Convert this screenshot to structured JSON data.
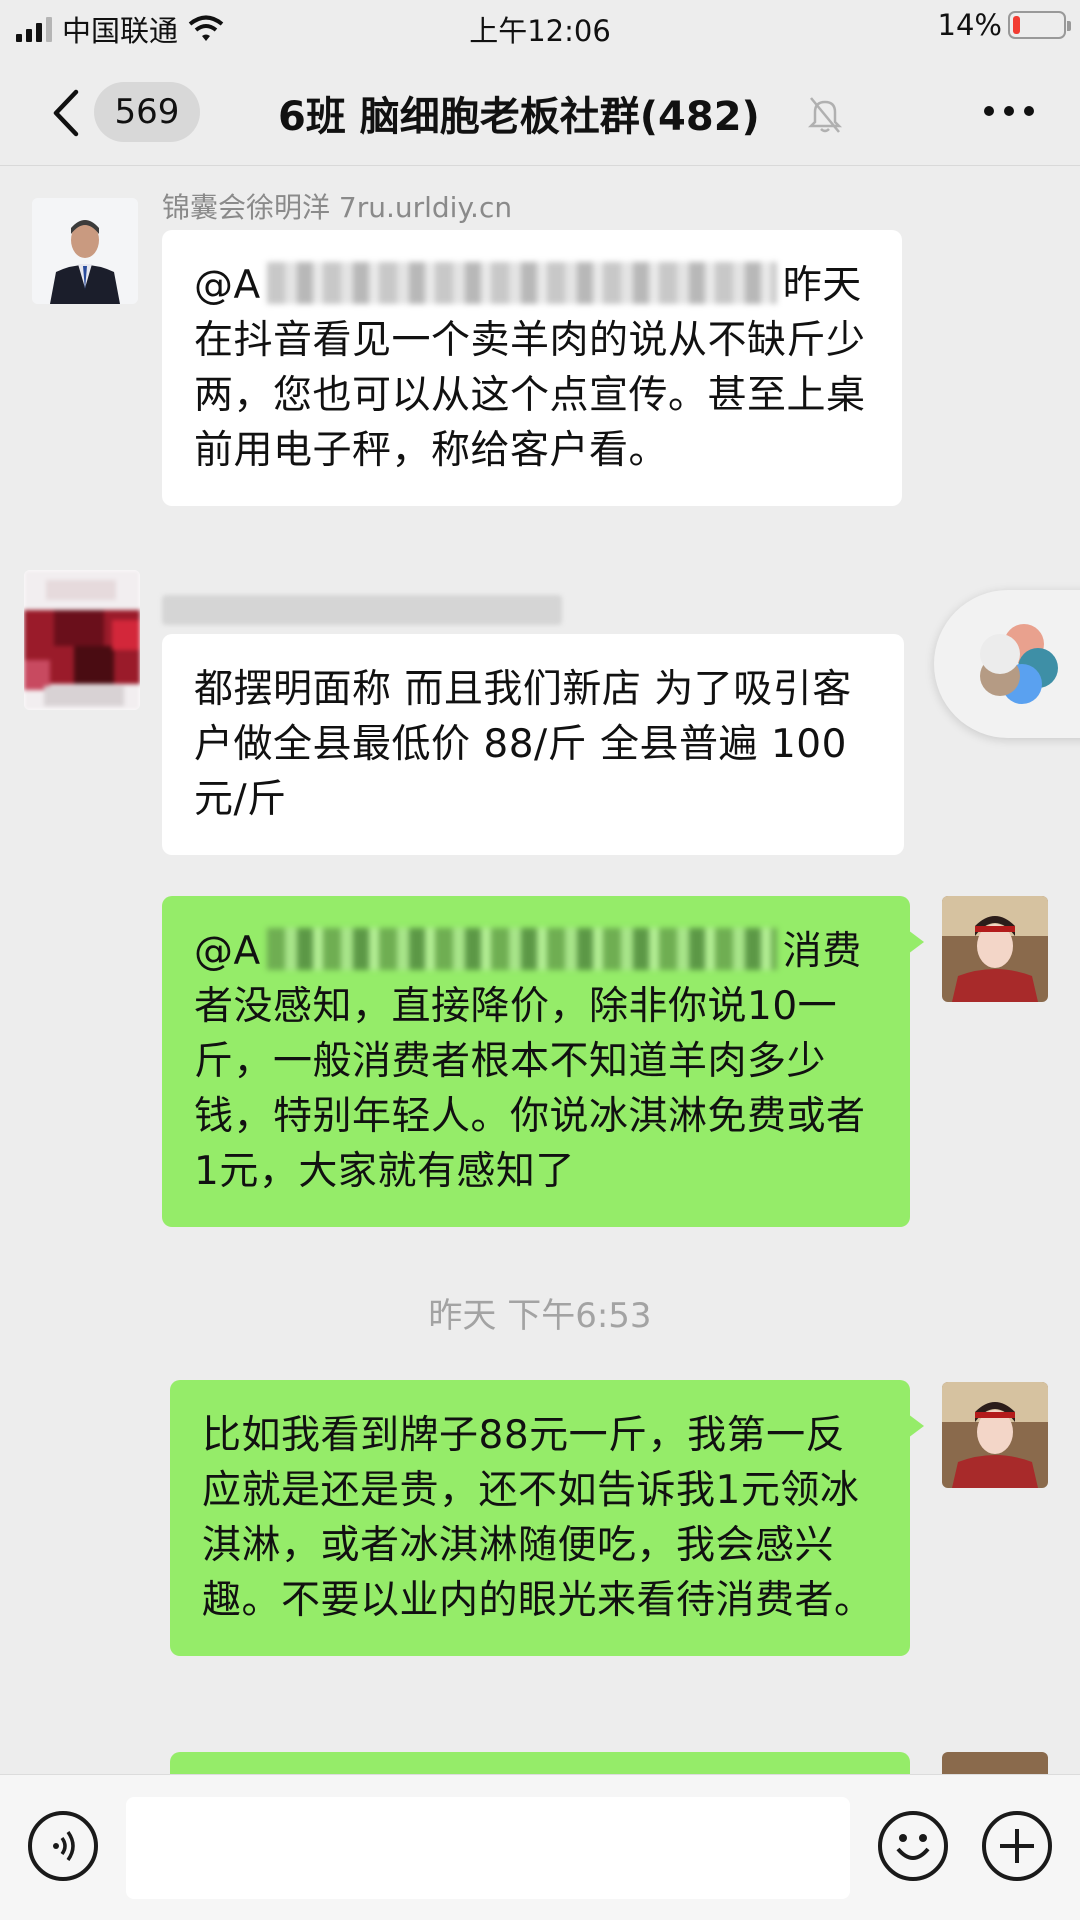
{
  "status_bar": {
    "carrier": "中国联通",
    "time": "上午12:06",
    "battery_percent": "14%",
    "battery_level": 0.14,
    "battery_color": "#f23c32"
  },
  "nav": {
    "back_icon": "chevron-left-icon",
    "unread_count": "569",
    "title": "6班 脑细胞老板社群(482)",
    "mute_icon": "bell-muted-icon",
    "more_icon": "more-horizontal-icon"
  },
  "messages": [
    {
      "direction": "incoming",
      "sender": "锦囊会徐明洋 7ru.urldiy.cn",
      "mention": "@A",
      "text": "昨天在抖音看见一个卖羊肉的说从不缺斤少两，您也可以从这个点宣传。甚至上桌前用电子秤，称给客户看。"
    },
    {
      "direction": "incoming",
      "sender": "",
      "text": "都摆明面称  而且我们新店  为了吸引客户做全县最低价 88/斤  全县普遍 100元/斤"
    },
    {
      "direction": "outgoing",
      "mention": "@A",
      "text": "消费者没感知，直接降价，除非你说10一斤，一般消费者根本不知道羊肉多少钱，特别年轻人。你说冰淇淋免费或者1元，大家就有感知了"
    },
    {
      "direction": "outgoing",
      "text": "比如我看到牌子88元一斤，我第一反应就是还是贵，还不如告诉我1元领冰淇淋，或者冰淇淋随便吃，我会感兴趣。不要以业内的眼光来看待消费者。"
    }
  ],
  "timestamp": "昨天 下午6:53",
  "input_bar": {
    "voice_icon": "voice-icon",
    "emoji_icon": "emoji-icon",
    "plus_icon": "plus-icon",
    "input_value": ""
  },
  "colors": {
    "background": "#ededed",
    "outgoing_bubble": "#95ec69",
    "incoming_bubble": "#ffffff"
  }
}
